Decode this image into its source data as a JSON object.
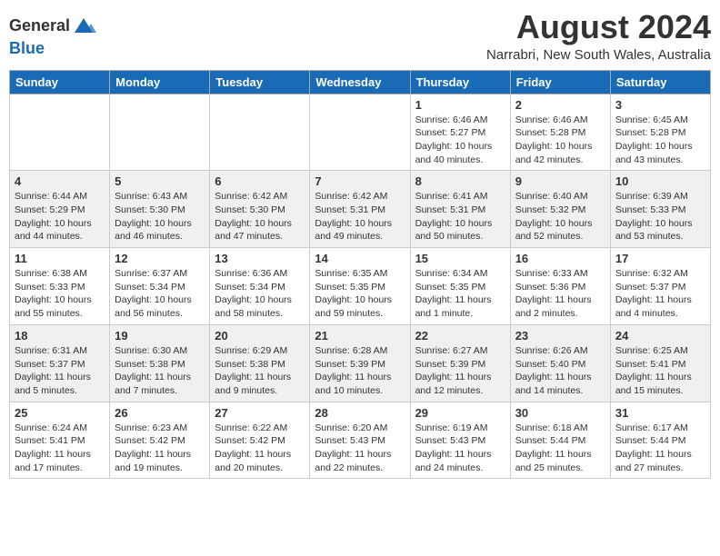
{
  "header": {
    "logo_line1": "General",
    "logo_line2": "Blue",
    "title": "August 2024",
    "subtitle": "Narrabri, New South Wales, Australia"
  },
  "weekdays": [
    "Sunday",
    "Monday",
    "Tuesday",
    "Wednesday",
    "Thursday",
    "Friday",
    "Saturday"
  ],
  "weeks": [
    [
      {
        "day": "",
        "info": ""
      },
      {
        "day": "",
        "info": ""
      },
      {
        "day": "",
        "info": ""
      },
      {
        "day": "",
        "info": ""
      },
      {
        "day": "1",
        "info": "Sunrise: 6:46 AM\nSunset: 5:27 PM\nDaylight: 10 hours\nand 40 minutes."
      },
      {
        "day": "2",
        "info": "Sunrise: 6:46 AM\nSunset: 5:28 PM\nDaylight: 10 hours\nand 42 minutes."
      },
      {
        "day": "3",
        "info": "Sunrise: 6:45 AM\nSunset: 5:28 PM\nDaylight: 10 hours\nand 43 minutes."
      }
    ],
    [
      {
        "day": "4",
        "info": "Sunrise: 6:44 AM\nSunset: 5:29 PM\nDaylight: 10 hours\nand 44 minutes."
      },
      {
        "day": "5",
        "info": "Sunrise: 6:43 AM\nSunset: 5:30 PM\nDaylight: 10 hours\nand 46 minutes."
      },
      {
        "day": "6",
        "info": "Sunrise: 6:42 AM\nSunset: 5:30 PM\nDaylight: 10 hours\nand 47 minutes."
      },
      {
        "day": "7",
        "info": "Sunrise: 6:42 AM\nSunset: 5:31 PM\nDaylight: 10 hours\nand 49 minutes."
      },
      {
        "day": "8",
        "info": "Sunrise: 6:41 AM\nSunset: 5:31 PM\nDaylight: 10 hours\nand 50 minutes."
      },
      {
        "day": "9",
        "info": "Sunrise: 6:40 AM\nSunset: 5:32 PM\nDaylight: 10 hours\nand 52 minutes."
      },
      {
        "day": "10",
        "info": "Sunrise: 6:39 AM\nSunset: 5:33 PM\nDaylight: 10 hours\nand 53 minutes."
      }
    ],
    [
      {
        "day": "11",
        "info": "Sunrise: 6:38 AM\nSunset: 5:33 PM\nDaylight: 10 hours\nand 55 minutes."
      },
      {
        "day": "12",
        "info": "Sunrise: 6:37 AM\nSunset: 5:34 PM\nDaylight: 10 hours\nand 56 minutes."
      },
      {
        "day": "13",
        "info": "Sunrise: 6:36 AM\nSunset: 5:34 PM\nDaylight: 10 hours\nand 58 minutes."
      },
      {
        "day": "14",
        "info": "Sunrise: 6:35 AM\nSunset: 5:35 PM\nDaylight: 10 hours\nand 59 minutes."
      },
      {
        "day": "15",
        "info": "Sunrise: 6:34 AM\nSunset: 5:35 PM\nDaylight: 11 hours\nand 1 minute."
      },
      {
        "day": "16",
        "info": "Sunrise: 6:33 AM\nSunset: 5:36 PM\nDaylight: 11 hours\nand 2 minutes."
      },
      {
        "day": "17",
        "info": "Sunrise: 6:32 AM\nSunset: 5:37 PM\nDaylight: 11 hours\nand 4 minutes."
      }
    ],
    [
      {
        "day": "18",
        "info": "Sunrise: 6:31 AM\nSunset: 5:37 PM\nDaylight: 11 hours\nand 5 minutes."
      },
      {
        "day": "19",
        "info": "Sunrise: 6:30 AM\nSunset: 5:38 PM\nDaylight: 11 hours\nand 7 minutes."
      },
      {
        "day": "20",
        "info": "Sunrise: 6:29 AM\nSunset: 5:38 PM\nDaylight: 11 hours\nand 9 minutes."
      },
      {
        "day": "21",
        "info": "Sunrise: 6:28 AM\nSunset: 5:39 PM\nDaylight: 11 hours\nand 10 minutes."
      },
      {
        "day": "22",
        "info": "Sunrise: 6:27 AM\nSunset: 5:39 PM\nDaylight: 11 hours\nand 12 minutes."
      },
      {
        "day": "23",
        "info": "Sunrise: 6:26 AM\nSunset: 5:40 PM\nDaylight: 11 hours\nand 14 minutes."
      },
      {
        "day": "24",
        "info": "Sunrise: 6:25 AM\nSunset: 5:41 PM\nDaylight: 11 hours\nand 15 minutes."
      }
    ],
    [
      {
        "day": "25",
        "info": "Sunrise: 6:24 AM\nSunset: 5:41 PM\nDaylight: 11 hours\nand 17 minutes."
      },
      {
        "day": "26",
        "info": "Sunrise: 6:23 AM\nSunset: 5:42 PM\nDaylight: 11 hours\nand 19 minutes."
      },
      {
        "day": "27",
        "info": "Sunrise: 6:22 AM\nSunset: 5:42 PM\nDaylight: 11 hours\nand 20 minutes."
      },
      {
        "day": "28",
        "info": "Sunrise: 6:20 AM\nSunset: 5:43 PM\nDaylight: 11 hours\nand 22 minutes."
      },
      {
        "day": "29",
        "info": "Sunrise: 6:19 AM\nSunset: 5:43 PM\nDaylight: 11 hours\nand 24 minutes."
      },
      {
        "day": "30",
        "info": "Sunrise: 6:18 AM\nSunset: 5:44 PM\nDaylight: 11 hours\nand 25 minutes."
      },
      {
        "day": "31",
        "info": "Sunrise: 6:17 AM\nSunset: 5:44 PM\nDaylight: 11 hours\nand 27 minutes."
      }
    ]
  ]
}
